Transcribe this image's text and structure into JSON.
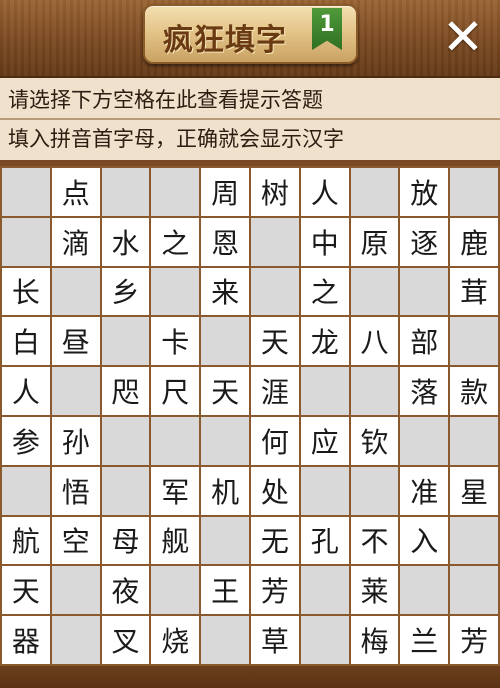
{
  "header": {
    "title": "疯狂填字",
    "level": "1",
    "close_label": "✕"
  },
  "hint": {
    "line1": "请选择下方空格在此查看提示答题",
    "line2": "填入拼音首字母，正确就会显示汉字"
  },
  "grid": {
    "rows": [
      [
        "",
        "点",
        "",
        "",
        "周",
        "树",
        "人",
        "",
        "放",
        ""
      ],
      [
        "",
        "滴",
        "水",
        "之",
        "恩",
        "",
        "中",
        "原",
        "逐",
        "鹿"
      ],
      [
        "长",
        "",
        "乡",
        "",
        "来",
        "",
        "之",
        "",
        "",
        "茸"
      ],
      [
        "白",
        "昼",
        "",
        "卡",
        "",
        "天",
        "龙",
        "八",
        "部",
        ""
      ],
      [
        "人",
        "",
        "咫",
        "尺",
        "天",
        "涯",
        "",
        "",
        "落",
        "款"
      ],
      [
        "参",
        "孙",
        "",
        "",
        "",
        "何",
        "应",
        "钦",
        "",
        ""
      ],
      [
        "",
        "悟",
        "",
        "军",
        "机",
        "处",
        "",
        "",
        "准",
        "星"
      ],
      [
        "航",
        "空",
        "母",
        "舰",
        "",
        "无",
        "孔",
        "不",
        "入",
        ""
      ],
      [
        "天",
        "",
        "夜",
        "",
        "王",
        "芳",
        "",
        "莱",
        "",
        ""
      ],
      [
        "器",
        "",
        "叉",
        "烧",
        "",
        "草",
        "",
        "梅",
        "兰",
        "芳"
      ]
    ]
  }
}
